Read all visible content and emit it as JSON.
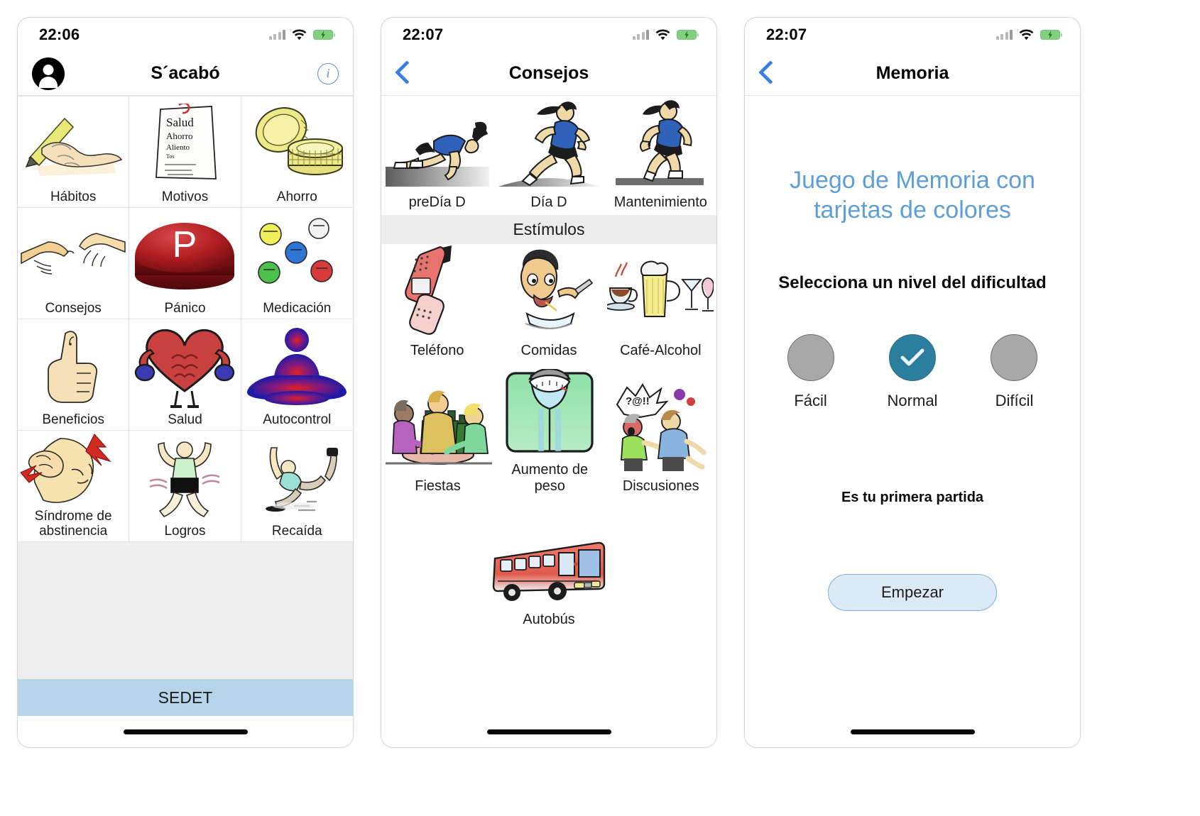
{
  "phones": [
    {
      "statusbar": {
        "time": "22:06",
        "signal_icon": "cellular-signal-icon",
        "wifi_icon": "wifi-icon",
        "battery_icon": "battery-charging-icon"
      },
      "nav": {
        "title": "S´acabó",
        "avatar_icon": "user-avatar-icon",
        "info_icon": "info-circle-icon"
      },
      "grid": [
        {
          "label": "Hábitos",
          "icon": "hand-writing-pencil-icon"
        },
        {
          "label": "Motivos",
          "icon": "notepad-list-icon",
          "note_lines": [
            "Salud",
            "Ahorro",
            "Aliento",
            "Tos"
          ]
        },
        {
          "label": "Ahorro",
          "icon": "stack-of-coins-icon"
        },
        {
          "label": "Consejos",
          "icon": "two-hands-pointing-icon"
        },
        {
          "label": "Pánico",
          "icon": "red-panic-button-icon",
          "button_letter": "P"
        },
        {
          "label": "Medicación",
          "icon": "pills-icon"
        },
        {
          "label": "Beneficios",
          "icon": "thumbs-up-icon"
        },
        {
          "label": "Salud",
          "icon": "muscular-heart-boxing-icon"
        },
        {
          "label": "Autocontrol",
          "icon": "meditating-person-icon"
        },
        {
          "label": "Síndrome de abstinencia",
          "icon": "headache-person-icon"
        },
        {
          "label": "Logros",
          "icon": "celebrating-person-icon"
        },
        {
          "label": "Recaída",
          "icon": "falling-person-icon"
        }
      ],
      "footer": {
        "label": "SEDET"
      }
    },
    {
      "statusbar": {
        "time": "22:07",
        "signal_icon": "cellular-signal-icon",
        "wifi_icon": "wifi-icon",
        "battery_icon": "battery-charging-icon"
      },
      "nav": {
        "title": "Consejos",
        "back_icon": "back-chevron-icon"
      },
      "stages": [
        {
          "label": "preDía D",
          "icon": "runner-crouch-start-icon"
        },
        {
          "label": "Día D",
          "icon": "runner-sprinting-icon"
        },
        {
          "label": "Mantenimiento",
          "icon": "runner-jogging-icon"
        }
      ],
      "section_header": "Estímulos",
      "stimuli": [
        {
          "label": "Teléfono",
          "icon": "cordless-phone-icon"
        },
        {
          "label": "Comidas",
          "icon": "person-eating-icon"
        },
        {
          "label": "Café-Alcohol",
          "icon": "coffee-beer-cocktail-icon"
        },
        {
          "label": "Fiestas",
          "icon": "party-table-bottles-icon"
        },
        {
          "label": "Aumento de peso",
          "icon": "bathroom-scale-icon"
        },
        {
          "label": "Discusiones",
          "icon": "people-arguing-icon"
        },
        {
          "label": "Autobús",
          "icon": "red-bus-icon"
        }
      ]
    },
    {
      "statusbar": {
        "time": "22:07",
        "signal_icon": "cellular-signal-icon",
        "wifi_icon": "wifi-icon",
        "battery_icon": "battery-charging-icon"
      },
      "nav": {
        "title": "Memoria",
        "back_icon": "back-chevron-icon"
      },
      "game_title": "Juego de Memoria con tarjetas de colores",
      "select_label": "Selecciona un nivel del dificultad",
      "levels": [
        {
          "label": "Fácil",
          "selected": false
        },
        {
          "label": "Normal",
          "selected": true
        },
        {
          "label": "Difícil",
          "selected": false
        }
      ],
      "status_text": "Es tu primera partida",
      "start_button": "Empezar"
    }
  ],
  "colors": {
    "accent_blue": "#3d7fe0",
    "title_blue": "#5e9ed6",
    "selected_teal": "#2b7e9e",
    "footer_blue": "#b7d5e8",
    "button_fill": "#dceaf8",
    "button_border": "#7fb0de",
    "section_grey": "#ececec",
    "filler_grey": "#eeeeee"
  }
}
